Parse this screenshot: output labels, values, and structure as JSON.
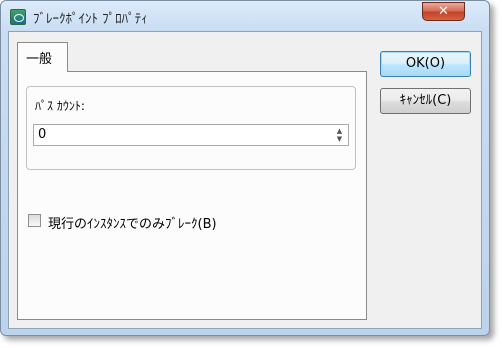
{
  "window": {
    "title": "ﾌﾞﾚｰｸﾎﾟｲﾝﾄ ﾌﾟﾛﾊﾟﾃｨ",
    "close_glyph": "✕"
  },
  "tabs": [
    {
      "label": "一般"
    }
  ],
  "group": {
    "label": "ﾊﾟｽ ｶｳﾝﾄ:",
    "spin_value": "0",
    "spin_up_glyph": "▲",
    "spin_down_glyph": "▼"
  },
  "checkbox": {
    "label": "現行のｲﾝｽﾀﾝｽでのみﾌﾞﾚｰｸ(B)",
    "checked": false
  },
  "buttons": {
    "ok_label": "OK(O)",
    "cancel_label": "ｷｬﾝｾﾙ(C)"
  },
  "colors": {
    "accent": "#3c7fb1",
    "close": "#c2432a"
  }
}
